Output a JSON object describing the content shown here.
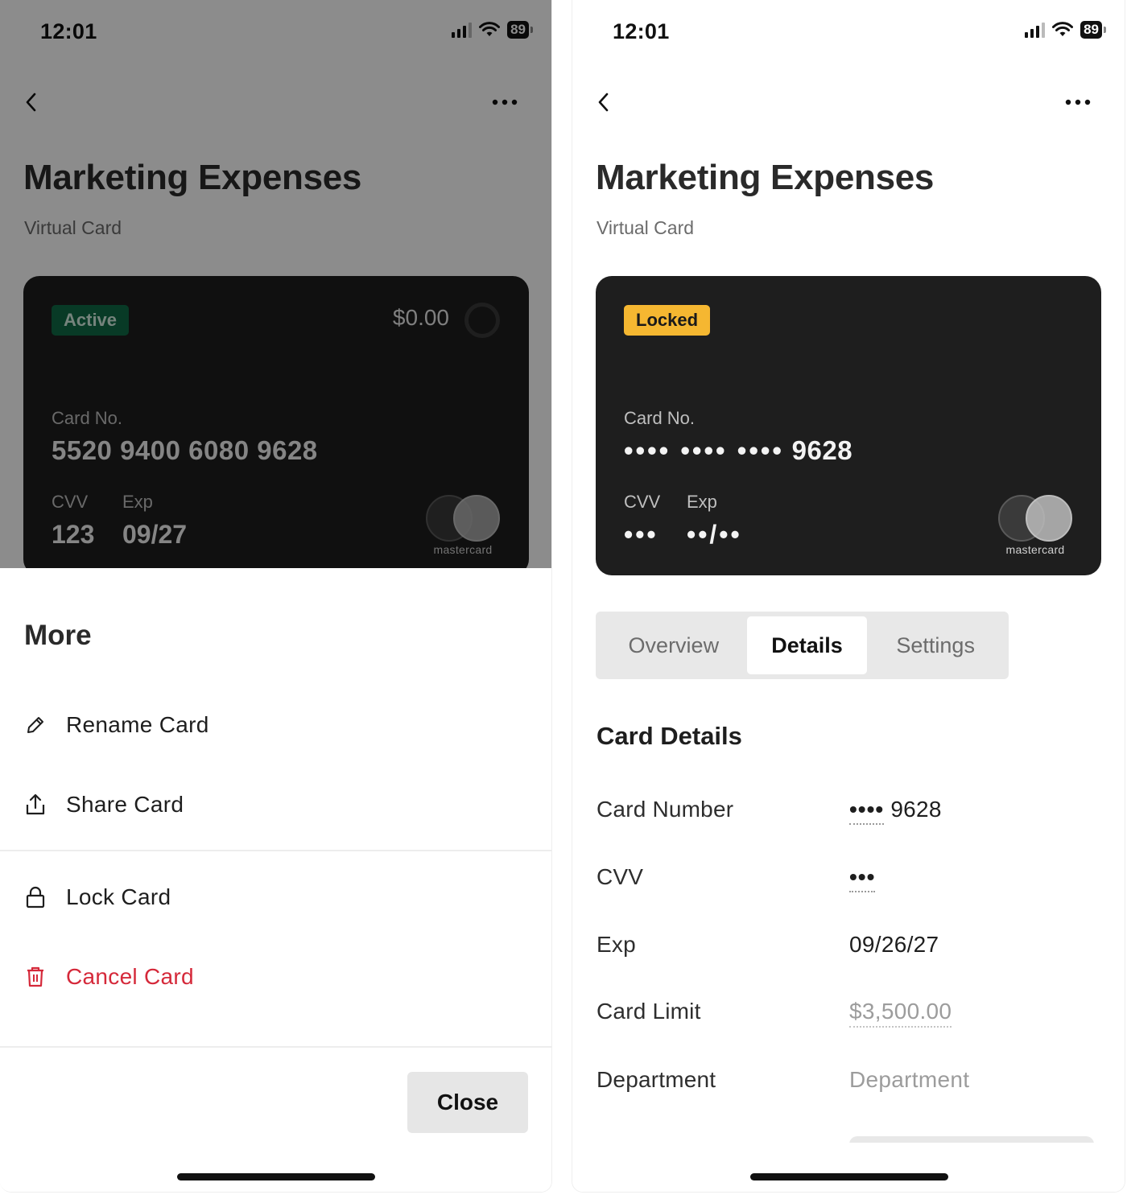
{
  "status_bar": {
    "time": "12:01",
    "battery": "89"
  },
  "header": {
    "title": "Marketing Expenses",
    "subtitle": "Virtual Card"
  },
  "left_card": {
    "status": "Active",
    "balance": "$0.00",
    "card_no_label": "Card No.",
    "card_number": "5520 9400 6080 9628",
    "cvv_label": "CVV",
    "cvv": "123",
    "exp_label": "Exp",
    "exp": "09/27",
    "network": "mastercard"
  },
  "more_sheet": {
    "title": "More",
    "items": [
      {
        "label": "Rename Card",
        "icon": "pencil-icon"
      },
      {
        "label": "Share Card",
        "icon": "share-icon"
      },
      {
        "label": "Lock Card",
        "icon": "lock-icon"
      },
      {
        "label": "Cancel Card",
        "icon": "trash-icon"
      }
    ],
    "close_label": "Close"
  },
  "right_card": {
    "status": "Locked",
    "card_no_label": "Card No.",
    "masked_groups": "•••• •••• ••••",
    "last4": "9628",
    "cvv_label": "CVV",
    "cvv_masked": "•••",
    "exp_label": "Exp",
    "exp_masked": "••/••",
    "network": "mastercard"
  },
  "tabs": [
    {
      "label": "Overview",
      "active": false
    },
    {
      "label": "Details",
      "active": true
    },
    {
      "label": "Settings",
      "active": false
    }
  ],
  "card_details": {
    "title": "Card Details",
    "rows": [
      {
        "label": "Card Number",
        "masked": "••••",
        "value": "9628"
      },
      {
        "label": "CVV",
        "masked": "•••",
        "value": ""
      },
      {
        "label": "Exp",
        "value": "09/26/27"
      },
      {
        "label": "Card Limit",
        "value": "$3,500.00"
      },
      {
        "label": "Department",
        "value": "Department"
      }
    ]
  },
  "colors": {
    "accent_active": "#0f6b46",
    "accent_locked": "#f5b731",
    "danger": "#d5293a",
    "card_bg": "#1e1e1e"
  }
}
